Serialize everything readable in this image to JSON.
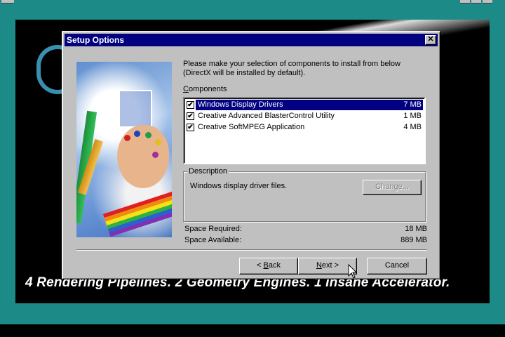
{
  "dialog": {
    "title": "Setup Options",
    "close_glyph": "✕",
    "intro": "Please make your selection of components to install from below (DirectX will be installed by default).",
    "components_label": "Components",
    "components_access_key": "C",
    "components_label_rest": "omponents",
    "components": [
      {
        "name": "Windows Display Drivers",
        "size": "7 MB",
        "checked": true,
        "selected": true
      },
      {
        "name": "Creative Advanced BlasterControl Utility",
        "size": "1 MB",
        "checked": true,
        "selected": false
      },
      {
        "name": "Creative SoftMPEG Application",
        "size": "4 MB",
        "checked": true,
        "selected": false
      }
    ],
    "description_label": "Description",
    "description_text": "Windows display driver files.",
    "change_button": "Change...",
    "space_required_label": "Space Required:",
    "space_required_value": "18 MB",
    "space_available_label": "Space Available:",
    "space_available_value": "889 MB",
    "back_prefix": "< ",
    "back_key": "B",
    "back_rest": "ack",
    "next_prefix": "",
    "next_key": "N",
    "next_rest": "ext >",
    "cancel_button": "Cancel"
  },
  "splash": {
    "tagline": "4 Rendering Pipelines.   2 Geometry Engines.   1 Insane Accelerator."
  },
  "colors": {
    "desktop": "#1c8a86",
    "titlebar": "#000080",
    "dialog_face": "#c0c0c0",
    "selection": "#000080"
  }
}
